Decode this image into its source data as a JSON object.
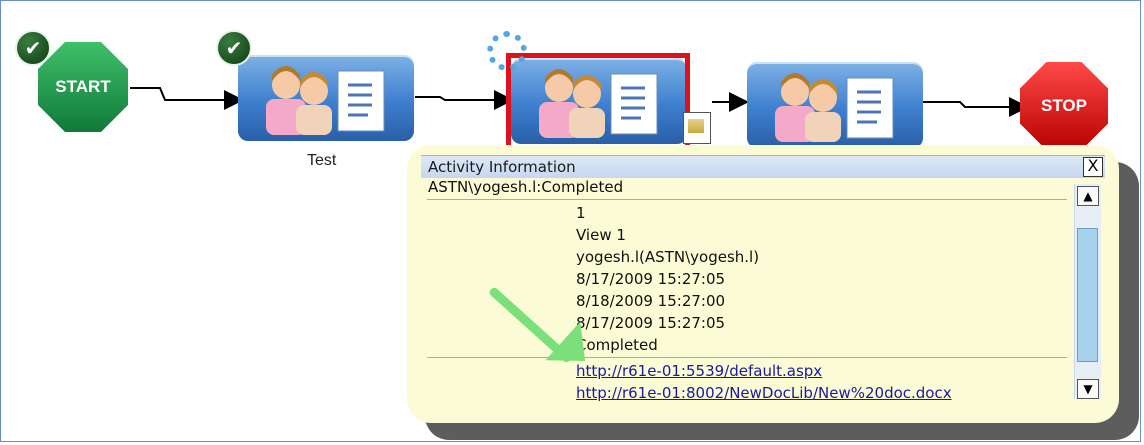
{
  "workflow": {
    "start_label": "START",
    "stop_label": "STOP",
    "tasks": [
      {
        "label": "Test"
      },
      {
        "label": ""
      },
      {
        "label": ""
      }
    ]
  },
  "popup": {
    "title": "Activity Information",
    "close_glyph": "X",
    "status_line": "ASTN\\yogesh.l:Completed",
    "details": [
      "1",
      "View 1",
      "yogesh.l(ASTN\\yogesh.l)",
      "8/17/2009 15:27:05",
      "8/18/2009 15:27:00",
      "8/17/2009 15:27:05",
      "Completed"
    ],
    "links": [
      "http://r61e-01:5539/default.aspx",
      "http://r61e-01:8002/NewDocLib/New%20doc.docx"
    ]
  },
  "icons": {
    "start": "start-octagon-icon",
    "stop": "stop-octagon-icon",
    "check": "check-icon",
    "task": "users-document-icon",
    "spinner": "loading-spinner-icon",
    "document": "document-icon",
    "arrow": "green-arrow-icon"
  },
  "colors": {
    "start": "#1b8f45",
    "stop": "#d10000",
    "task_blue": "#3d7fce",
    "selected_border": "#e0101c",
    "popup_bg": "#fbfbd6",
    "link": "#1a1a9e"
  }
}
